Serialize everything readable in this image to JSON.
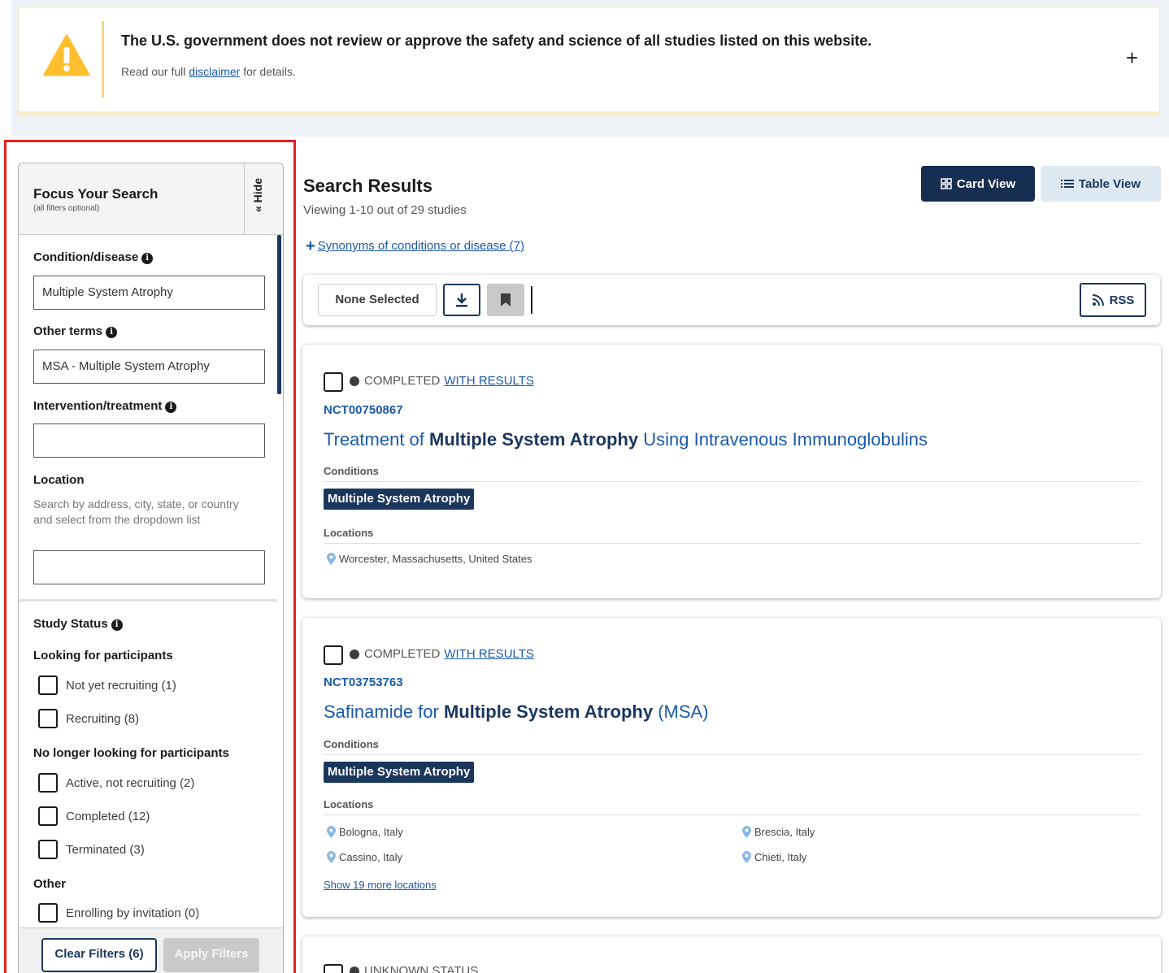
{
  "disclaimer": {
    "title": "The U.S. government does not review or approve the safety and science of all studies listed on this website.",
    "sub_prefix": "Read our full",
    "link": "disclaimer",
    "sub_suffix": "for details.",
    "expand": "+"
  },
  "sidebar": {
    "title": "Focus Your Search",
    "subtitle": "(all filters optional)",
    "hide": "« Hide",
    "condition": {
      "label": "Condition/disease",
      "value": "Multiple System Atrophy"
    },
    "other_terms": {
      "label": "Other terms",
      "value": "MSA - Multiple System Atrophy"
    },
    "intervention": {
      "label": "Intervention/treatment",
      "value": ""
    },
    "location": {
      "label": "Location",
      "help": "Search by address, city, state, or country and select from the dropdown list",
      "value": ""
    },
    "study_status": {
      "label": "Study Status",
      "looking_label": "Looking for participants",
      "looking": [
        "Not yet recruiting (1)",
        "Recruiting (8)"
      ],
      "no_longer_label": "No longer looking for participants",
      "no_longer": [
        "Active, not recruiting (2)",
        "Completed (12)",
        "Terminated (3)"
      ],
      "other_label": "Other",
      "other": [
        "Enrolling by invitation (0)"
      ]
    },
    "clear": "Clear Filters (6)",
    "apply": "Apply Filters"
  },
  "results": {
    "title": "Search Results",
    "count": "Viewing 1-10 out of 29 studies",
    "synonyms": "Synonyms of conditions or disease (7)",
    "card_view": "Card View",
    "table_view": "Table View"
  },
  "toolbar": {
    "none_selected": "None Selected",
    "rss": "RSS"
  },
  "cards": [
    {
      "status": "COMPLETED",
      "status_link": "WITH RESULTS",
      "nct": "NCT00750867",
      "title_pre": "Treatment of ",
      "title_bold": "Multiple System Atrophy",
      "title_post": " Using Intravenous Immunoglobulins",
      "conditions_label": "Conditions",
      "condition_tag": "Multiple System Atrophy",
      "locations_label": "Locations",
      "locations": [
        "Worcester, Massachusetts, United States"
      ]
    },
    {
      "status": "COMPLETED",
      "status_link": "WITH RESULTS",
      "nct": "NCT03753763",
      "title_pre": "Safinamide for ",
      "title_bold": "Multiple System Atrophy",
      "title_post": " (MSA)",
      "conditions_label": "Conditions",
      "condition_tag": "Multiple System Atrophy",
      "locations_label": "Locations",
      "locations": [
        "Bologna, Italy",
        "Brescia, Italy",
        "Cassino, Italy",
        "Chieti, Italy"
      ],
      "more": "Show 19 more locations"
    },
    {
      "status": "UNKNOWN STATUS"
    }
  ],
  "colors": {
    "navy": "#162e51",
    "link": "#1a5aa6",
    "warning": "#ffbe2e",
    "highlight": "#e3211c"
  },
  "icons": {
    "warning": "warning-triangle-icon",
    "info": "info-icon",
    "download": "download-icon",
    "bookmark": "bookmark-icon",
    "rss": "rss-icon",
    "location": "location-pin-icon",
    "card_view": "grid-icon",
    "table_view": "list-icon"
  }
}
